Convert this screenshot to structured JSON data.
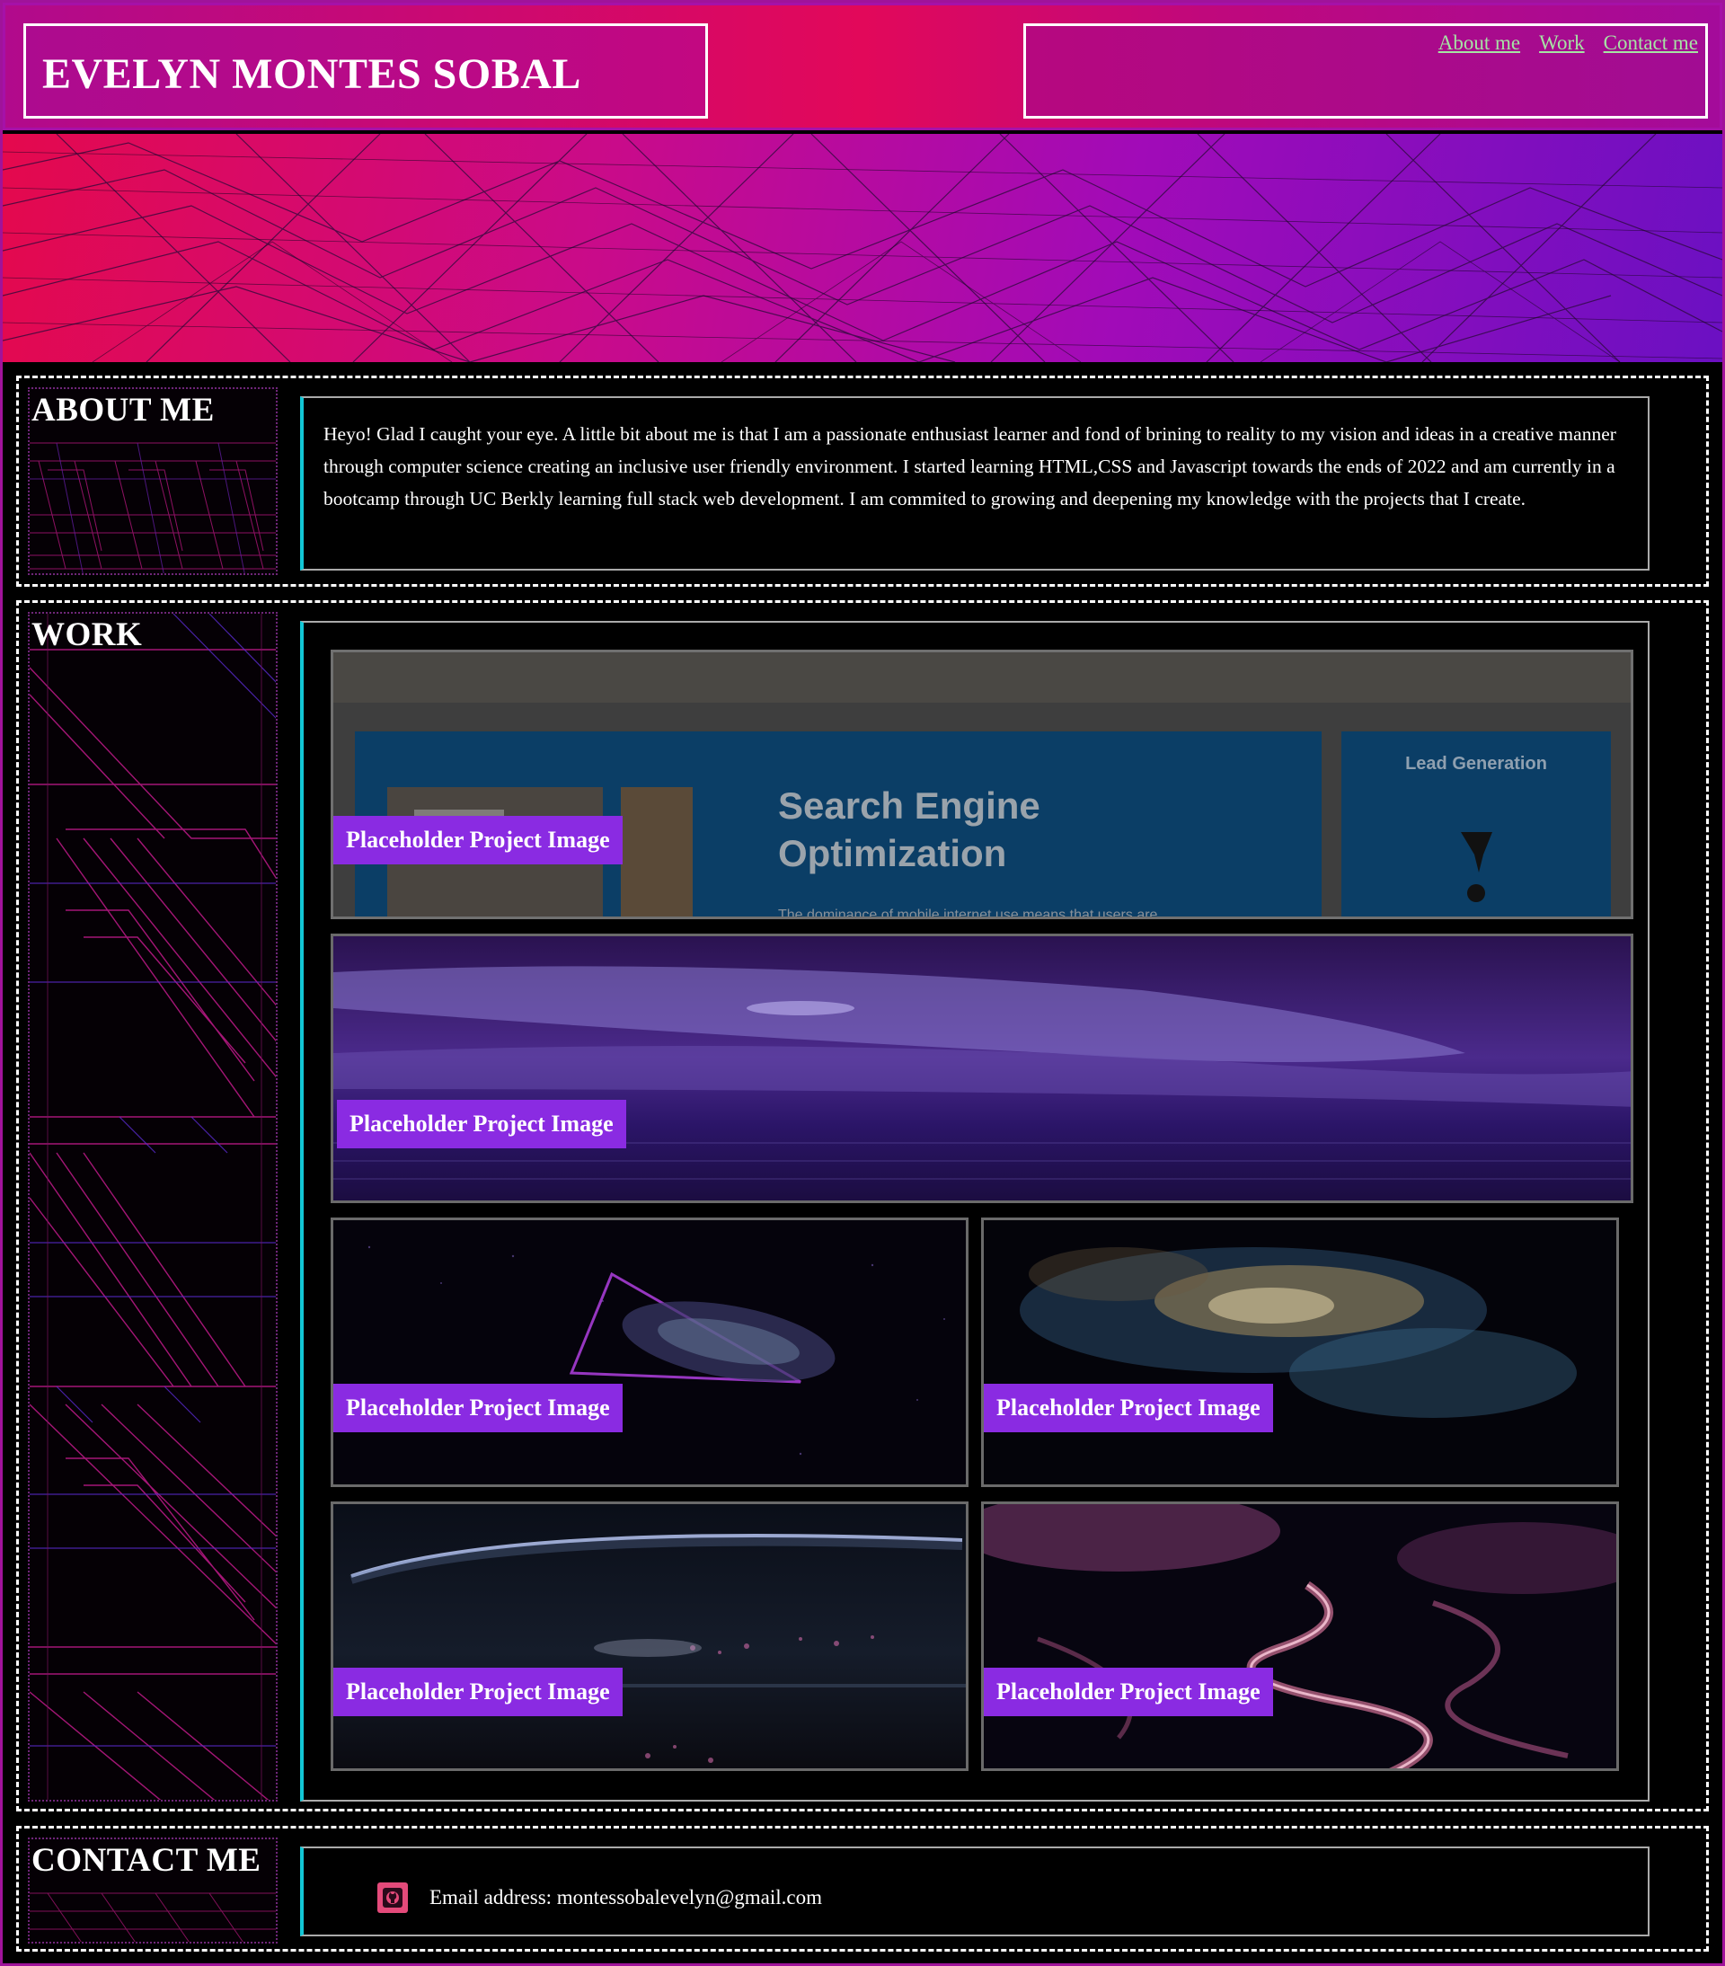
{
  "header": {
    "title": "EVELYN MONTES SOBAL",
    "nav": [
      "About me",
      "Work",
      "Contact me"
    ]
  },
  "about": {
    "heading": "ABOUT ME",
    "text": "Heyo! Glad I caught your eye. A little bit about me is that I am a passionate enthusiast learner and fond of brining to reality to my vision and ideas in a creative manner through computer science creating an inclusive user friendly environment. I started learning HTML,CSS and Javascript towards the ends of 2022 and am currently in a bootcamp through UC Berkly learning full stack web development. I am commited to growing and deepening my knowledge with the projects that I create."
  },
  "work": {
    "heading": "WORK",
    "projects": [
      {
        "label": "Placeholder Project Image",
        "thumb": "seo",
        "screenshot_text": {
          "title": "Search Engine Optimization",
          "side": "Lead Generation",
          "caption": "The dominance of mobile internet use means that users are"
        }
      },
      {
        "label": "Placeholder Project Image",
        "thumb": "purple-wave"
      },
      {
        "label": "Placeholder Project Image",
        "thumb": "neon-prism"
      },
      {
        "label": "Placeholder Project Image",
        "thumb": "nebula"
      },
      {
        "label": "Placeholder Project Image",
        "thumb": "moon-shore"
      },
      {
        "label": "Placeholder Project Image",
        "thumb": "blossom-river"
      }
    ]
  },
  "contact": {
    "heading": "CONTACT ME",
    "email_line": "Email address: montessobalevelyn@gmail.com",
    "icon": "github-icon"
  },
  "colors": {
    "accent_purple": "#8a2be2",
    "accent_cyan": "#12c7d6",
    "nav_link": "#a6e3a4",
    "header_pink": "#e2085a"
  }
}
